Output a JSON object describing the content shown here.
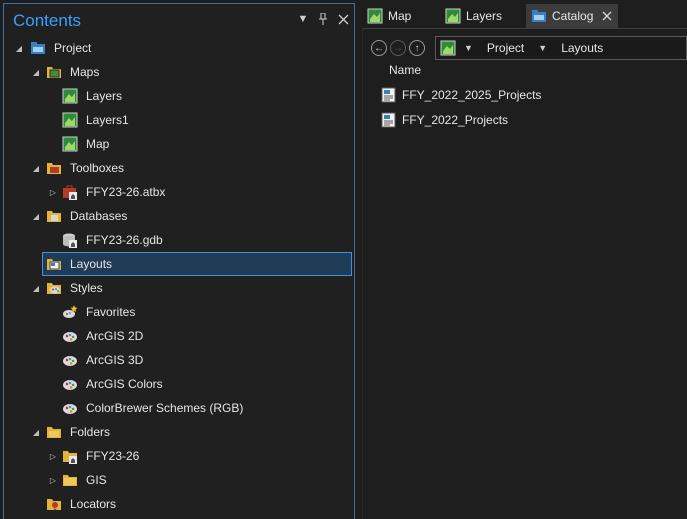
{
  "contents": {
    "title": "Contents",
    "tree": {
      "project": "Project",
      "maps": "Maps",
      "map_items": [
        "Layers",
        "Layers1",
        "Map"
      ],
      "toolboxes": "Toolboxes",
      "toolbox_items": [
        "FFY23-26.atbx"
      ],
      "databases": "Databases",
      "database_items": [
        "FFY23-26.gdb"
      ],
      "layouts": "Layouts",
      "styles": "Styles",
      "style_items": [
        "Favorites",
        "ArcGIS 2D",
        "ArcGIS 3D",
        "ArcGIS Colors",
        "ColorBrewer Schemes (RGB)"
      ],
      "folders": "Folders",
      "folder_items": [
        "FFY23-26",
        "GIS"
      ],
      "locators": "Locators"
    },
    "selected": "Layouts"
  },
  "tabs": [
    {
      "label": "Map",
      "icon": "map-icon"
    },
    {
      "label": "Layers",
      "icon": "map-icon"
    },
    {
      "label": "Catalog",
      "icon": "catalog-icon",
      "active": true
    }
  ],
  "catalog": {
    "path": [
      "Project",
      "Layouts"
    ],
    "column_header": "Name",
    "items": [
      "FFY_2022_2025_Projects",
      "FFY_2022_Projects"
    ]
  },
  "colors": {
    "accent": "#3aa0ff",
    "selection": "#1f3b55",
    "selection_border": "#4a90d9",
    "folder": "#e2b53a"
  }
}
